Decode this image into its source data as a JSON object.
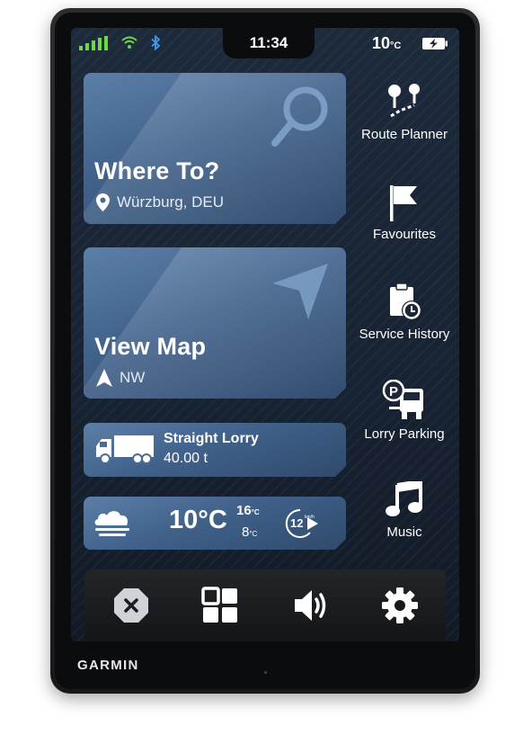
{
  "device": {
    "brand": "GARMIN"
  },
  "status_bar": {
    "time": "11:34",
    "temperature": "10",
    "temperature_unit": "°C"
  },
  "where_to": {
    "title": "Where To?",
    "location": "Würzburg, DEU"
  },
  "view_map": {
    "title": "View Map",
    "heading": "NW"
  },
  "vehicle": {
    "type": "Straight Lorry",
    "weight": "40.00 t"
  },
  "weather": {
    "temperature": "10°C",
    "high": "16",
    "low": "8",
    "unit": "°C",
    "wind_speed": "12",
    "wind_unit": "km/h"
  },
  "sidebar": {
    "items": [
      {
        "label": "Route Planner",
        "icon": "route-planner-icon"
      },
      {
        "label": "Favourites",
        "icon": "flag-icon"
      },
      {
        "label": "Service History",
        "icon": "service-history-icon"
      },
      {
        "label": "Lorry Parking",
        "icon": "lorry-parking-icon"
      },
      {
        "label": "Music",
        "icon": "music-note-icon"
      }
    ]
  },
  "bottom_bar": {
    "buttons": [
      "close-icon",
      "apps-grid-icon",
      "volume-icon",
      "settings-gear-icon"
    ]
  },
  "colors": {
    "card_blue": "#4a6c96",
    "background": "#1a2637",
    "text": "#ffffff"
  }
}
